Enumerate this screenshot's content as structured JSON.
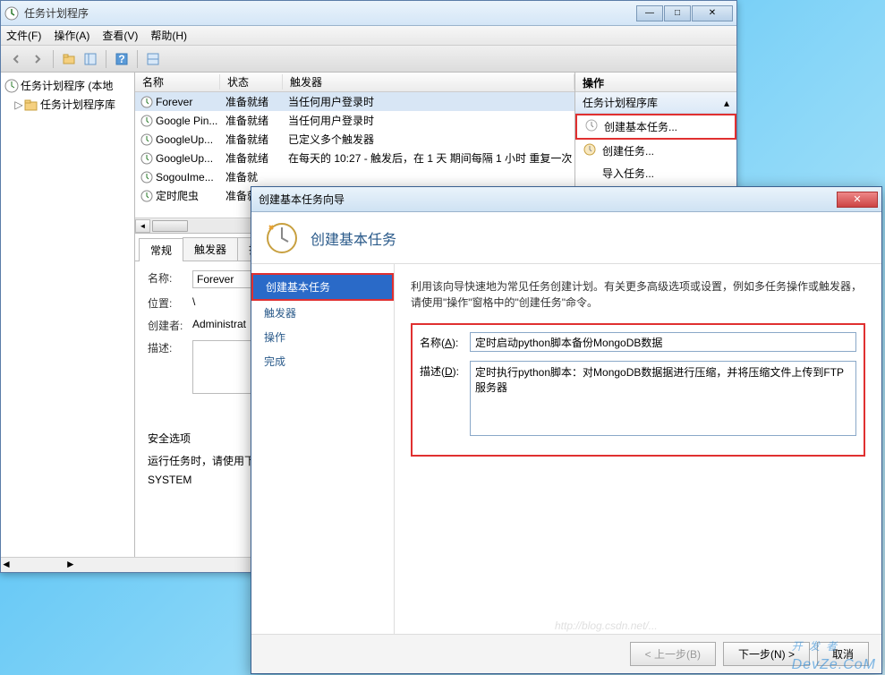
{
  "main_window": {
    "title": "任务计划程序",
    "menu": {
      "file": "文件(F)",
      "action": "操作(A)",
      "view": "查看(V)",
      "help": "帮助(H)"
    },
    "tree": {
      "root": "任务计划程序 (本地",
      "child": "任务计划程序库"
    },
    "task_list": {
      "headers": {
        "name": "名称",
        "status": "状态",
        "trigger": "触发器"
      },
      "rows": [
        {
          "name": "Forever",
          "status": "准备就绪",
          "trigger": "当任何用户登录时"
        },
        {
          "name": "Google Pin...",
          "status": "准备就绪",
          "trigger": "当任何用户登录时"
        },
        {
          "name": "GoogleUp...",
          "status": "准备就绪",
          "trigger": "已定义多个触发器"
        },
        {
          "name": "GoogleUp...",
          "status": "准备就绪",
          "trigger": "在每天的 10:27 - 触发后，在 1 天 期间每隔 1 小时 重复一次"
        },
        {
          "name": "SogouIme...",
          "status": "准备就",
          "trigger": ""
        },
        {
          "name": "定时爬虫",
          "status": "准备就",
          "trigger": ""
        }
      ]
    },
    "detail": {
      "tabs": {
        "general": "常规",
        "triggers": "触发器",
        "actions": "操作"
      },
      "labels": {
        "name": "名称:",
        "location": "位置:",
        "author": "创建者:",
        "desc": "描述:",
        "security": "安全选项",
        "runtext": "运行任务时，请使用下",
        "system": "SYSTEM"
      },
      "values": {
        "name": "Forever",
        "location": "\\",
        "author": "Administrat"
      }
    },
    "actions": {
      "header": "操作",
      "section": "任务计划程序库",
      "items": {
        "create_basic": "创建基本任务...",
        "create": "创建任务...",
        "import": "导入任务..."
      }
    }
  },
  "wizard": {
    "title": "创建基本任务向导",
    "header_title": "创建基本任务",
    "nav": {
      "basic": "创建基本任务",
      "trigger": "触发器",
      "action": "操作",
      "finish": "完成"
    },
    "desc": "利用该向导快速地为常见任务创建计划。有关更多高级选项或设置，例如多任务操作或触发器，请使用\"操作\"窗格中的\"创建任务\"命令。",
    "labels": {
      "name": "名称(A):",
      "desc": "描述(D):"
    },
    "values": {
      "name": "定时启动python脚本备份MongoDB数据",
      "desc": "定时执行python脚本：对MongoDB数据据进行压缩，并将压缩文件上传到FTP服务器"
    },
    "buttons": {
      "back": "< 上一步(B)",
      "next": "下一步(N) >",
      "cancel": "取消"
    }
  },
  "watermark": {
    "main": "开 发 者",
    "sub": "DevZe.CoM"
  },
  "faded_url": "http://blog.csdn.net/..."
}
